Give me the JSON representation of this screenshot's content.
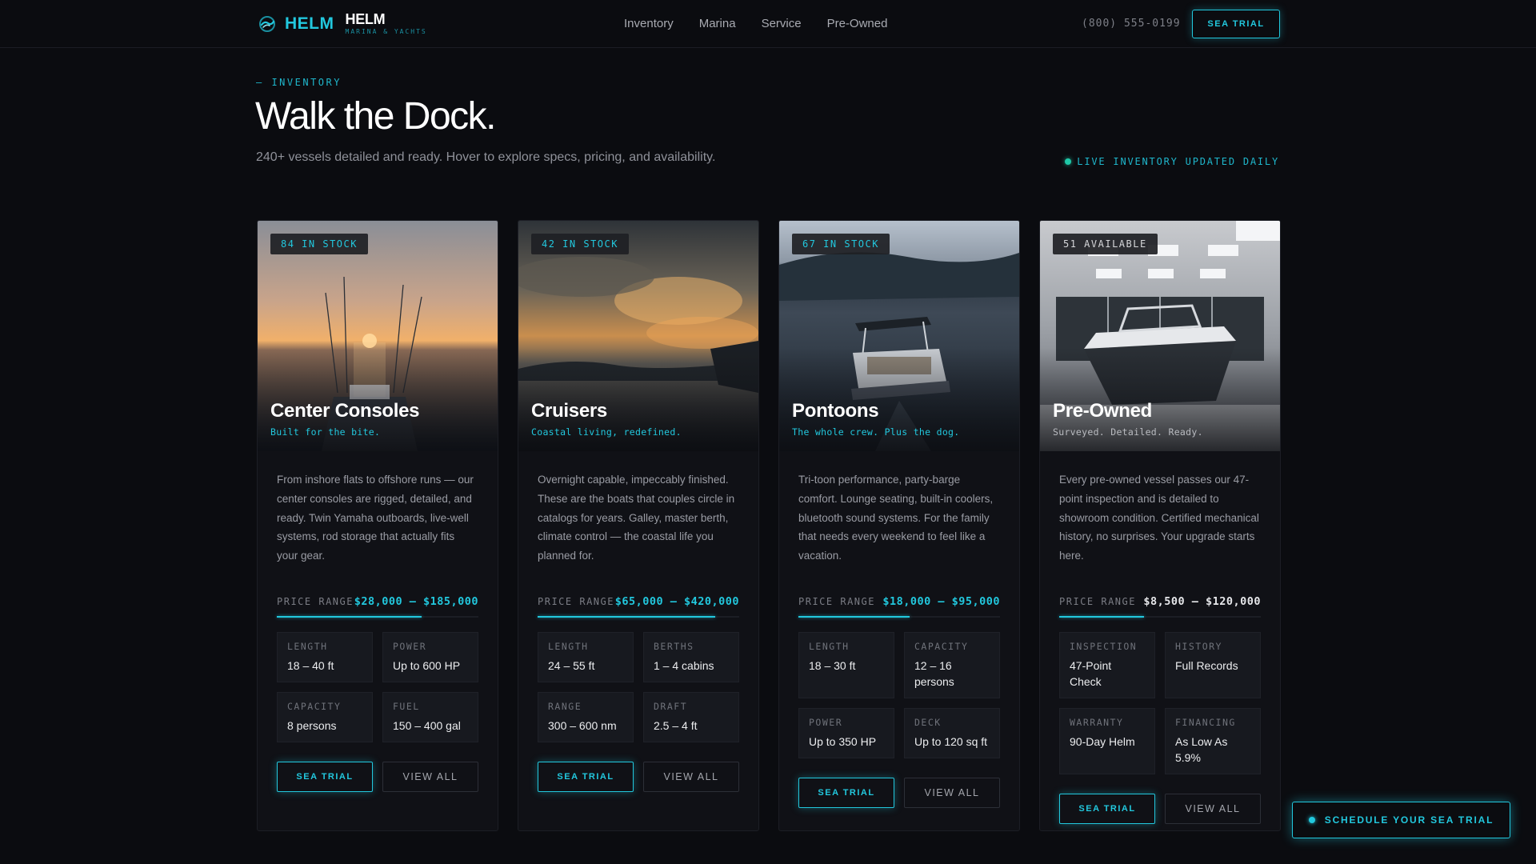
{
  "nav": {
    "logo_accent": "HELM",
    "logo_main": "HELM",
    "logo_sub": "MARINA & YACHTS",
    "links": [
      "Inventory",
      "Marina",
      "Service",
      "Pre-Owned"
    ],
    "phone": "(800) 555-0199",
    "cta": "SEA TRIAL"
  },
  "header": {
    "eyebrow": "— INVENTORY",
    "title": "Walk the Dock.",
    "subtitle": "240+ vessels detailed and ready. Hover to explore specs, pricing, and availability.",
    "live": "LIVE INVENTORY UPDATED DAILY"
  },
  "colors": {
    "accent": "#22c8de",
    "background": "#0b0c10",
    "card": "#101116",
    "live_dot": "#1fc9a8"
  },
  "cards": [
    {
      "badge": "84 IN STOCK",
      "title": "Center Consoles",
      "tagline": "Built for the bite.",
      "description": "From inshore flats to offshore runs — our center consoles are rigged, detailed, and ready. Twin Yamaha outboards, live-well systems, rod storage that actually fits your gear.",
      "price_label": "PRICE RANGE",
      "price": "$28,000 – $185,000",
      "price_fill": 0.72,
      "specs": [
        {
          "label": "LENGTH",
          "value": "18 – 40 ft"
        },
        {
          "label": "POWER",
          "value": "Up to 600 HP"
        },
        {
          "label": "CAPACITY",
          "value": "8 persons"
        },
        {
          "label": "FUEL",
          "value": "150 – 400 gal"
        }
      ],
      "primary": "SEA TRIAL",
      "secondary": "VIEW ALL"
    },
    {
      "badge": "42 IN STOCK",
      "title": "Cruisers",
      "tagline": "Coastal living, redefined.",
      "description": "Overnight capable, impeccably finished. These are the boats that couples circle in catalogs for years. Galley, master berth, climate control — the coastal life you planned for.",
      "price_label": "PRICE RANGE",
      "price": "$65,000 – $420,000",
      "price_fill": 0.88,
      "specs": [
        {
          "label": "LENGTH",
          "value": "24 – 55 ft"
        },
        {
          "label": "BERTHS",
          "value": "1 – 4 cabins"
        },
        {
          "label": "RANGE",
          "value": "300 – 600 nm"
        },
        {
          "label": "DRAFT",
          "value": "2.5 – 4 ft"
        }
      ],
      "primary": "SEA TRIAL",
      "secondary": "VIEW ALL"
    },
    {
      "badge": "67 IN STOCK",
      "title": "Pontoons",
      "tagline": "The whole crew. Plus the dog.",
      "description": "Tri-toon performance, party-barge comfort. Lounge seating, built-in coolers, bluetooth sound systems. For the family that needs every weekend to feel like a vacation.",
      "price_label": "PRICE RANGE",
      "price": "$18,000 – $95,000",
      "price_fill": 0.55,
      "specs": [
        {
          "label": "LENGTH",
          "value": "18 – 30 ft"
        },
        {
          "label": "CAPACITY",
          "value": "12 – 16 persons"
        },
        {
          "label": "POWER",
          "value": "Up to 350 HP"
        },
        {
          "label": "DECK",
          "value": "Up to 120 sq ft"
        }
      ],
      "primary": "SEA TRIAL",
      "secondary": "VIEW ALL"
    },
    {
      "badge": "51 AVAILABLE",
      "title": "Pre-Owned",
      "tagline": "Surveyed. Detailed. Ready.",
      "description": "Every pre-owned vessel passes our 47-point inspection and is detailed to showroom condition. Certified mechanical history, no surprises. Your upgrade starts here.",
      "price_label": "PRICE RANGE",
      "price": "$8,500 – $120,000",
      "price_fill": 0.42,
      "specs": [
        {
          "label": "INSPECTION",
          "value": "47-Point Check"
        },
        {
          "label": "HISTORY",
          "value": "Full Records"
        },
        {
          "label": "WARRANTY",
          "value": "90-Day Helm"
        },
        {
          "label": "FINANCING",
          "value": "As Low As 5.9%"
        }
      ],
      "primary": "SEA TRIAL",
      "secondary": "VIEW ALL"
    }
  ],
  "floating_cta": "SCHEDULE YOUR SEA TRIAL"
}
